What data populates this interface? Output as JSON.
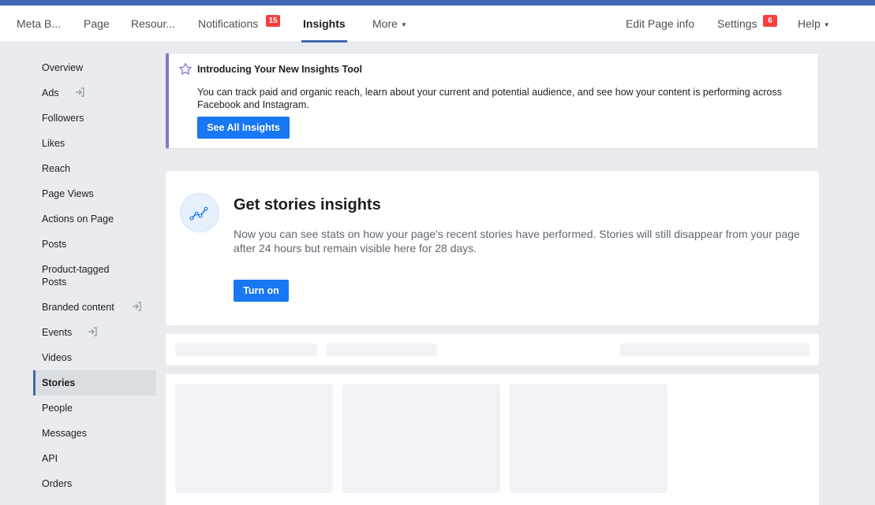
{
  "topnav": {
    "items": [
      {
        "label": "Meta B..."
      },
      {
        "label": "Page"
      },
      {
        "label": "Resour..."
      },
      {
        "label": "Notifications",
        "badge": "15"
      },
      {
        "label": "Insights"
      },
      {
        "label": "More"
      }
    ],
    "right": [
      {
        "label": "Edit Page info"
      },
      {
        "label": "Settings",
        "badge": "6"
      },
      {
        "label": "Help"
      }
    ],
    "active": "Insights"
  },
  "sidebar": {
    "items": [
      {
        "label": "Overview"
      },
      {
        "label": "Ads",
        "icon": "external-link-icon"
      },
      {
        "label": "Followers"
      },
      {
        "label": "Likes"
      },
      {
        "label": "Reach"
      },
      {
        "label": "Page Views"
      },
      {
        "label": "Actions on Page"
      },
      {
        "label": "Posts"
      },
      {
        "label": "Product-tagged Posts"
      },
      {
        "label": "Branded content",
        "icon": "external-link-icon"
      },
      {
        "label": "Events",
        "icon": "external-link-icon"
      },
      {
        "label": "Videos"
      },
      {
        "label": "Stories"
      },
      {
        "label": "People"
      },
      {
        "label": "Messages"
      },
      {
        "label": "API"
      },
      {
        "label": "Orders"
      }
    ],
    "active": "Stories"
  },
  "banner": {
    "icon": "star-icon",
    "title": "Introducing Your New Insights Tool",
    "text": "You can track paid and organic reach, learn about your current and potential audience, and see how your content is performing across Facebook and Instagram.",
    "button": "See All Insights",
    "accent": "#8c72cb"
  },
  "stories": {
    "icon": "chart-line-icon",
    "title": "Get stories insights",
    "text": "Now you can see stats on how your page's recent stories have performed. Stories will still disappear from your page after 24 hours but remain visible here for 28 days.",
    "button": "Turn on"
  },
  "colors": {
    "brand": "#4267b2",
    "button": "#1877f2",
    "badge": "#fa3e3e",
    "background": "#e9ebee"
  }
}
